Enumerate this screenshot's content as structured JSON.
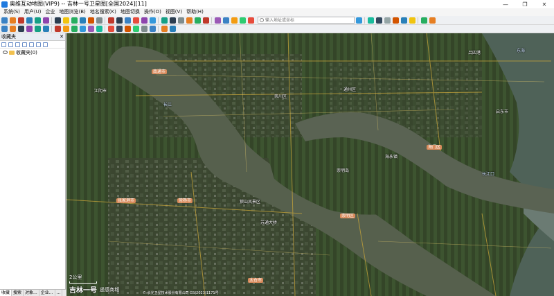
{
  "window": {
    "title": "奥维互动地图(VIP9) -- 吉林一号卫星图[全国2024][11]",
    "minimize": "—",
    "maximize": "❐",
    "close": "✕"
  },
  "menu": [
    "系统(S)",
    "用户(U)",
    "企业",
    "地图浏览(B)",
    "地名搜索(K)",
    "地图切换",
    "操作(O)",
    "视图(V)",
    "帮助(H)"
  ],
  "toolbar": {
    "search_placeholder": "输入地址或坐标",
    "icon_colors_row1": [
      "#3b82c4",
      "#e67e22",
      "#c0392b",
      "#2980b9",
      "#16a085",
      "#8e44ad",
      "#2c3e50",
      "#f1c40f",
      "#27ae60",
      "#2980b9",
      "#d35400",
      "#7f8c8d",
      "#c0392b",
      "#2c3e50",
      "#3b82c4",
      "#e74c3c",
      "#8e44ad",
      "#3498db",
      "#16a085",
      "#2c3e50",
      "#7f8c8d",
      "#e67e22",
      "#27ae60",
      "#c0392b",
      "#9b59b6",
      "#3b82c4",
      "#f39c12",
      "#2ecc71",
      "#e74c3c",
      "#3498db",
      "#1abc9c",
      "#34495e",
      "#95a5a6",
      "#d35400",
      "#2980b9",
      "#f1c40f",
      "#27ae60",
      "#e67e22"
    ],
    "icon_colors_row2": [
      "#3b82c4",
      "#e67e22",
      "#2c3e50",
      "#8e44ad",
      "#16a085",
      "#2980b9",
      "#c0392b",
      "#f39c12",
      "#27ae60",
      "#3498db",
      "#9b59b6",
      "#1abc9c",
      "#e74c3c",
      "#34495e",
      "#d35400",
      "#2ecc71",
      "#7f8c8d",
      "#3b82c4",
      "#e67e22",
      "#2980b9"
    ]
  },
  "left_panel": {
    "header": "收藏夹",
    "pin": "✕",
    "tree": [
      {
        "label": "收藏夹(0)"
      }
    ],
    "bottom_tabs": [
      "收藏",
      "搜索",
      "对象...",
      "企业...",
      "..."
    ]
  },
  "map": {
    "scale_label": "2公里",
    "watermark": "吉林一号",
    "watermark_sub": "遥感商城",
    "copyright": "© 长光卫星技术股份有限公司 GS(2023)1171号",
    "labels": [
      {
        "text": "南通市"
      },
      {
        "text": "崇川区"
      },
      {
        "text": "通州区"
      },
      {
        "text": "海门区"
      },
      {
        "text": "常熟市"
      },
      {
        "text": "张家港市"
      },
      {
        "text": "江阴市"
      },
      {
        "text": "太仓市"
      },
      {
        "text": "崇明区"
      },
      {
        "text": "启东市"
      },
      {
        "text": "长江"
      },
      {
        "text": "狼山风景区"
      },
      {
        "text": "苏通大桥"
      },
      {
        "text": "吕四港"
      },
      {
        "text": "长江口"
      },
      {
        "text": "东海"
      },
      {
        "text": "崇明岛"
      },
      {
        "text": "海永镇"
      }
    ]
  }
}
